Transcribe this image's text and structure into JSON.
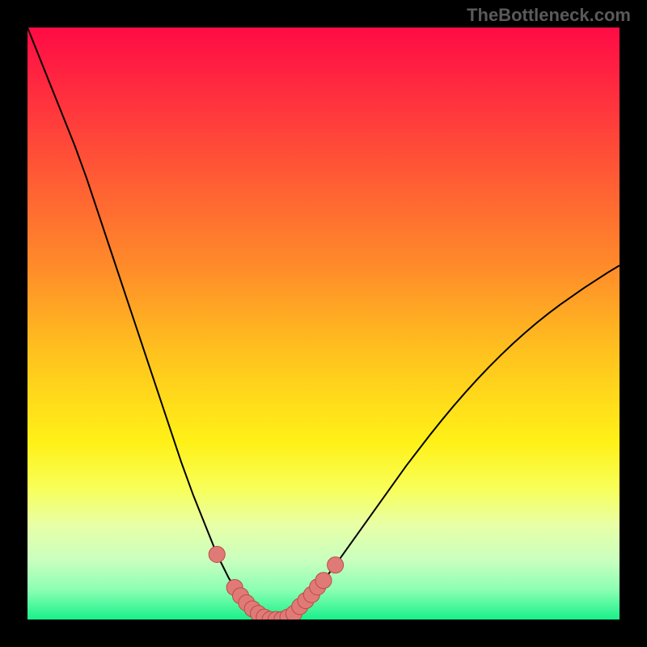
{
  "watermark": "TheBottleneck.com",
  "colors": {
    "curve_stroke": "#000000",
    "marker_fill": "#e07a77",
    "marker_stroke": "#bb4a48",
    "gradient": [
      "#ff0b45",
      "#ff2a3f",
      "#ff5a35",
      "#ff8a2a",
      "#ffc21e",
      "#fff117",
      "#f8ff5a",
      "#e8ffa6",
      "#c9ffbf",
      "#8bffb3",
      "#18f08a"
    ]
  },
  "chart_data": {
    "type": "line",
    "title": "",
    "xlabel": "",
    "ylabel": "",
    "xlim": [
      0,
      100
    ],
    "ylim": [
      0,
      100
    ],
    "grid": false,
    "legend": false,
    "x": [
      0,
      2,
      4,
      6,
      8,
      10,
      12,
      14,
      16,
      18,
      20,
      22,
      24,
      26,
      28,
      30,
      31,
      32,
      33,
      34,
      35,
      36,
      37,
      38,
      39,
      40,
      41,
      42,
      43,
      44,
      45,
      46,
      48,
      50,
      52,
      54,
      56,
      58,
      60,
      62,
      64,
      66,
      68,
      70,
      72,
      74,
      76,
      78,
      80,
      82,
      84,
      86,
      88,
      90,
      92,
      94,
      96,
      98,
      100
    ],
    "values": [
      100,
      95,
      90,
      85,
      80,
      74.5,
      68.5,
      62.5,
      56.5,
      50.5,
      44.5,
      38.5,
      32.5,
      26.5,
      21,
      16,
      13.5,
      11,
      9,
      7,
      5.4,
      4,
      2.8,
      1.8,
      1,
      0.4,
      0,
      0,
      0,
      0.4,
      1,
      2.2,
      4.2,
      6.6,
      9.2,
      12,
      14.8,
      17.6,
      20.4,
      23.2,
      26,
      28.6,
      31.2,
      33.7,
      36.1,
      38.4,
      40.6,
      42.7,
      44.7,
      46.6,
      48.4,
      50.1,
      51.7,
      53.2,
      54.6,
      56,
      57.3,
      58.6,
      59.8
    ],
    "markers": [
      {
        "x": 32,
        "y": 11
      },
      {
        "x": 35,
        "y": 5.4
      },
      {
        "x": 36,
        "y": 4
      },
      {
        "x": 37,
        "y": 2.8
      },
      {
        "x": 38,
        "y": 1.8
      },
      {
        "x": 39,
        "y": 1
      },
      {
        "x": 40,
        "y": 0.4
      },
      {
        "x": 41,
        "y": 0
      },
      {
        "x": 42,
        "y": 0
      },
      {
        "x": 43,
        "y": 0
      },
      {
        "x": 44,
        "y": 0.4
      },
      {
        "x": 45,
        "y": 1
      },
      {
        "x": 46,
        "y": 2.2
      },
      {
        "x": 47,
        "y": 3.2
      },
      {
        "x": 48,
        "y": 4.2
      },
      {
        "x": 49,
        "y": 5.5
      },
      {
        "x": 50,
        "y": 6.6
      },
      {
        "x": 52,
        "y": 9.2
      }
    ]
  }
}
